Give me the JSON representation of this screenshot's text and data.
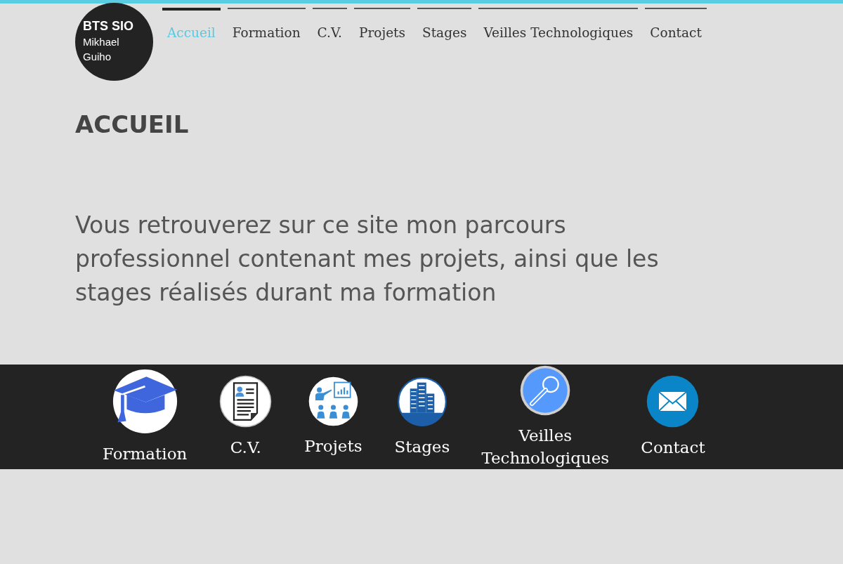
{
  "logo": {
    "title": "BTS SIO",
    "author": "Mikhael Guiho"
  },
  "nav": [
    {
      "label": "Accueil",
      "selected": true
    },
    {
      "label": "Formation",
      "selected": false
    },
    {
      "label": "C.V.",
      "selected": false
    },
    {
      "label": "Projets",
      "selected": false
    },
    {
      "label": "Stages",
      "selected": false
    },
    {
      "label": "Veilles Technologiques",
      "selected": false
    },
    {
      "label": "Contact",
      "selected": false
    }
  ],
  "page": {
    "heading": "ACCUEIL",
    "intro": "Vous retrouverez sur ce site mon parcours professionnel contenant mes projets, ainsi que les stages réalisés durant ma formation"
  },
  "shortcuts": [
    {
      "label": "Formation"
    },
    {
      "label": "C.V."
    },
    {
      "label": "Projets"
    },
    {
      "label": "Stages"
    },
    {
      "label": "Veilles Technologiques"
    },
    {
      "label": "Contact"
    }
  ]
}
